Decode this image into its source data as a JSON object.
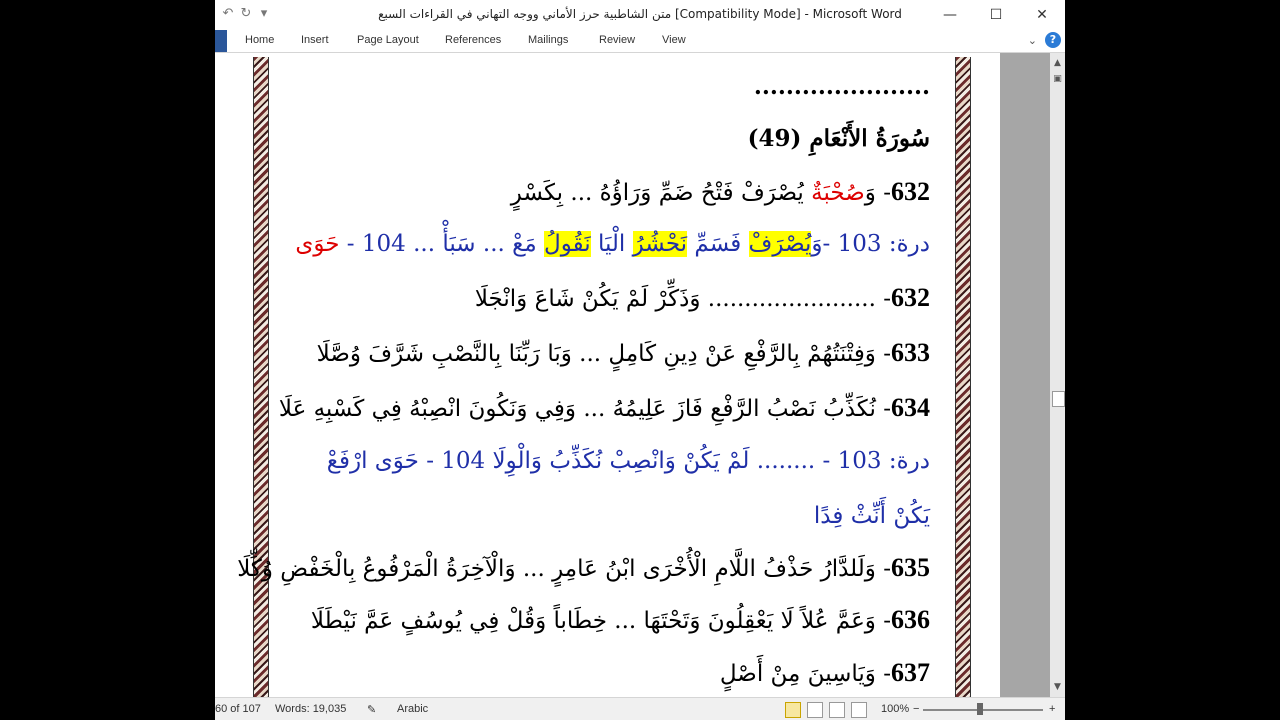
{
  "window": {
    "title": "متن الشاطبية حرز الأماني ووجه التهاني في القراءات السبع [Compatibility Mode]  -  Microsoft Word",
    "controls": [
      "—",
      "☐",
      "✕"
    ]
  },
  "qat": {
    "undo_icon": "↶",
    "redo_icon": "↻",
    "more_icon": "▾"
  },
  "ribbon": {
    "tabs": [
      "Home",
      "Insert",
      "Page Layout",
      "References",
      "Mailings",
      "Review",
      "View"
    ],
    "help_icon": "?"
  },
  "document": {
    "lines": [
      {
        "text": "......................"
      },
      {
        "text": "سُورَةُ الأَنْعَامِ (49)"
      },
      {
        "num": "632",
        "pre": "- وَ",
        "red": "صُحْبَةٌ",
        "post": " يُصْرَفْ فَتْحُ ضَمِّ وَرَاؤُهُ ... بِكَسْرٍ"
      },
      {
        "pre": "درة: 103 -وَ",
        "hl1": "يُصْرَفْ",
        "mid": " فَسَمِّ ",
        "hl2": "نَحْشُرُ",
        "mid2": " الْيَا ",
        "hl3": "نَقُولُ",
        "post": " مَعْ ... سَبَأْ ...  104 - ",
        "red": "حَوَى"
      },
      {
        "num": "632",
        "text": "- ....................... وَذَكِّرْ لَمْ يَكُنْ شَاعَ وَانْجَلَا"
      },
      {
        "num": "633",
        "text": "- وَفِتْنَتُهُمْ بِالرَّفْعِ عَنْ دِينِ كَامِلٍ ... وَبَا رَبِّنَا بِالنَّصْبِ شَرَّفَ وُصَّلَا"
      },
      {
        "num": "634",
        "text": "- نُكَذِّبُ نَصْبُ الرَّفْعِ فَازَ عَلِيمُهُ ... وَفِي وَنَكُونَ انْصِبْهُ فِي كَسْبِهِ عَلَا"
      },
      {
        "text": "درة: 103 - ........ لَمْ يَكُنْ وَانْصِبْ نُكَذِّبُ وَالْوِلَا        104 - حَوَى ارْفَعْ"
      },
      {
        "text": "يَكُنْ أَنِّثْ فِدًا"
      },
      {
        "num": "635",
        "text": "- وَلَلدَّارُ حَذْفُ اللَّامِ الْأُخْرَى ابْنُ عَامِرٍ ... وَالْآخِرَةُ الْمَرْفُوعُ بِالْخَفْضِ وُكِّلَا"
      },
      {
        "num": "636",
        "text": "- وَعَمَّ عُلاً لَا يَعْقِلُونَ وَتَحْتَهَا ... خِطَاباً وَقُلْ فِي يُوسُفٍ عَمَّ نَيْطَلَا"
      },
      {
        "num": "637",
        "text": "- وَيَاسِينَ مِنْ أَصْلٍ"
      }
    ]
  },
  "status": {
    "page": "60 of 107",
    "words": "Words: 19,035",
    "language": "Arabic",
    "zoom": "100%",
    "zoom_minus": "−",
    "zoom_plus": "+"
  }
}
